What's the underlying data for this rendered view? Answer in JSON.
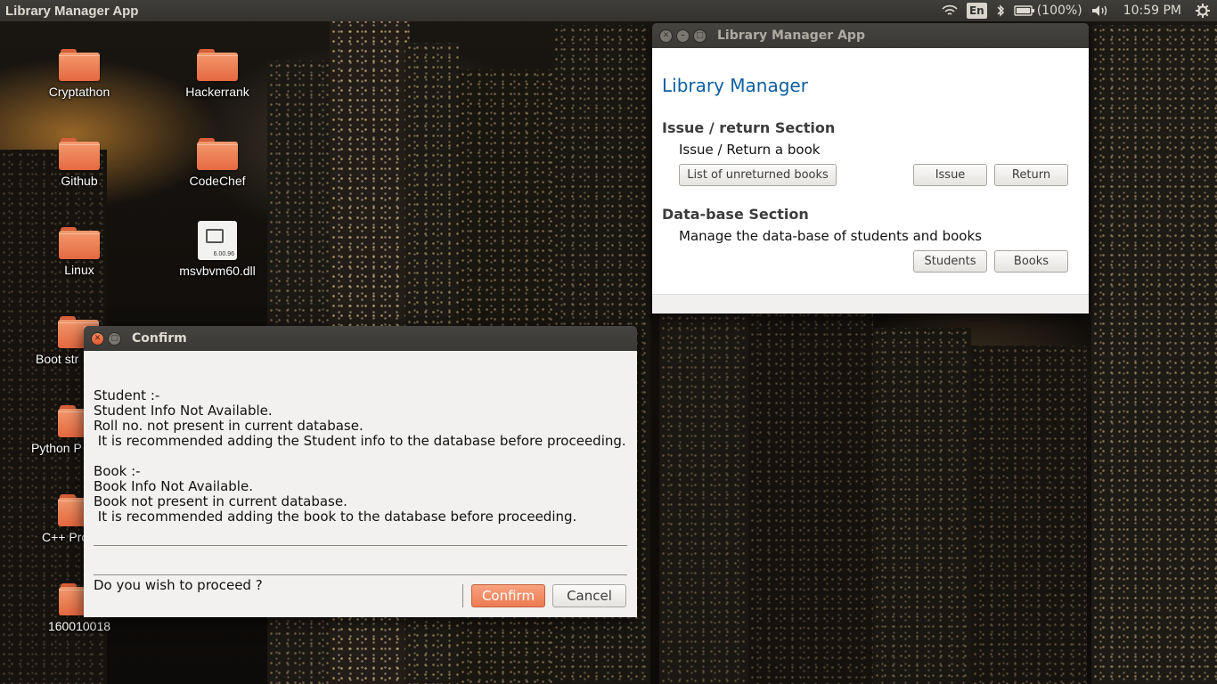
{
  "colors": {
    "accent_orange": "#ec7b52",
    "link_blue": "#0d5fa0",
    "panel_bg": "#3a3935",
    "folder_orange": "#e6683f"
  },
  "top_panel": {
    "app_title": "Library Manager App",
    "keyboard_layout": "En",
    "battery": "(100%)",
    "clock": "10:59 PM",
    "icons": [
      "wifi-icon",
      "bluetooth-icon",
      "battery-icon",
      "volume-icon",
      "settings-gear-icon"
    ]
  },
  "desktop": {
    "icons": [
      {
        "label": "Cryptathon",
        "type": "folder"
      },
      {
        "label": "Hackerrank",
        "type": "folder"
      },
      {
        "label": "Github",
        "type": "folder"
      },
      {
        "label": "CodeChef",
        "type": "folder"
      },
      {
        "label": "Linux",
        "type": "folder"
      },
      {
        "label": "msvbvm60.dll",
        "type": "file",
        "tag": "6.00.96"
      },
      {
        "label": "Boot str",
        "type": "folder"
      },
      {
        "label": "Python P",
        "type": "folder"
      },
      {
        "label": "C++ Pro",
        "type": "folder"
      },
      {
        "label": "160010018",
        "type": "folder"
      }
    ]
  },
  "library_window": {
    "title": "Library Manager App",
    "heading": "Library Manager",
    "issue_section": {
      "title": "Issue / return Section",
      "description": "Issue / Return a book",
      "buttons": {
        "unreturned": "List of unreturned books",
        "issue": "Issue",
        "return": "Return"
      }
    },
    "db_section": {
      "title": "Data-base Section",
      "description": "Manage the data-base of students and books",
      "buttons": {
        "students": "Students",
        "books": "Books"
      }
    }
  },
  "confirm_dialog": {
    "title": "Confirm",
    "message_lines": [
      "Student :-",
      "Student Info Not Available.",
      "Roll no. not present in current database.",
      " It is recommended adding the Student info to the database before proceeding.",
      "",
      "Book :-",
      "Book Info Not Available.",
      "Book not present in current database.",
      " It is recommended adding the book to the database before proceeding."
    ],
    "question": "Do you wish to proceed ?",
    "buttons": {
      "confirm": "Confirm",
      "cancel": "Cancel"
    }
  }
}
